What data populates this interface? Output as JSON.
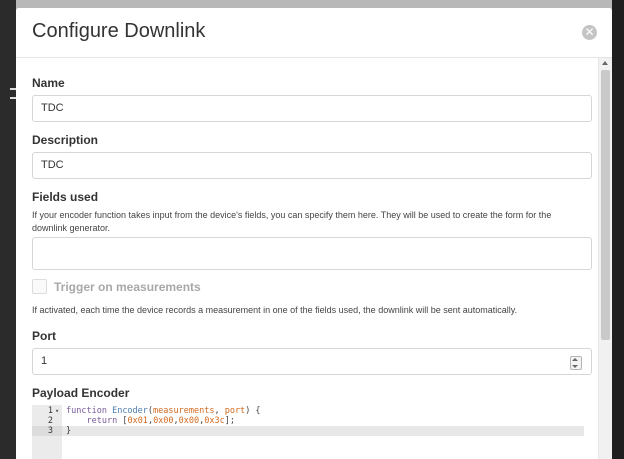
{
  "modal": {
    "title": "Configure Downlink",
    "close_icon": "close-icon"
  },
  "form": {
    "name": {
      "label": "Name",
      "value": "TDC"
    },
    "description": {
      "label": "Description",
      "value": "TDC"
    },
    "fields_used": {
      "label": "Fields used",
      "help": "If your encoder function takes input from the device's fields, you can specify them here. They will be used to create the form for the downlink generator.",
      "value": ""
    },
    "trigger": {
      "label": "Trigger on measurements",
      "checked": false,
      "help": "If activated, each time the device records a measurement in one of the fields used, the downlink will be sent automatically."
    },
    "port": {
      "label": "Port",
      "value": "1"
    },
    "payload_encoder": {
      "label": "Payload Encoder",
      "line_numbers": [
        "1",
        "2",
        "3"
      ],
      "fold_marker": "▾",
      "code": {
        "l1_kw": "function",
        "l1_name": "Encoder",
        "l1_open": "(",
        "l1_p1": "measurements",
        "l1_comma": ", ",
        "l1_p2": "port",
        "l1_close": ") {",
        "l2_indent": "    ",
        "l2_kw": "return",
        "l2_open": " [",
        "l2_v1": "0x01",
        "l2_v2": "0x00",
        "l2_v3": "0x00",
        "l2_v4": "0x3c",
        "l2_sep": ",",
        "l2_close": "];",
        "l3": "}"
      }
    }
  }
}
